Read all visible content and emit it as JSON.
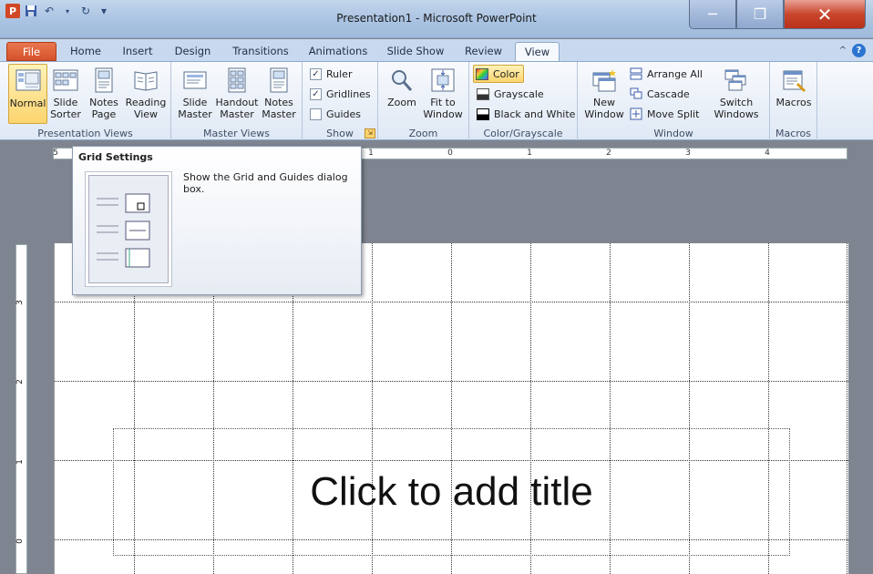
{
  "window": {
    "title": "Presentation1  -  Microsoft PowerPoint",
    "minimize": "─",
    "maximize": "❐",
    "close": "✕"
  },
  "qat": {
    "app_icon": "P",
    "save": "💾",
    "undo": "↶",
    "redo": "↻",
    "customize": "▾"
  },
  "tabs": [
    "File",
    "Home",
    "Insert",
    "Design",
    "Transitions",
    "Animations",
    "Slide Show",
    "Review",
    "View"
  ],
  "active_tab": "View",
  "ribbon": {
    "presentation_views": {
      "label": "Presentation Views",
      "normal": "Normal",
      "slide_sorter": "Slide Sorter",
      "notes_page": "Notes Page",
      "reading_view": "Reading View"
    },
    "master_views": {
      "label": "Master Views",
      "slide_master": "Slide Master",
      "handout_master": "Handout Master",
      "notes_master": "Notes Master"
    },
    "show": {
      "label": "Show",
      "ruler": "Ruler",
      "gridlines": "Gridlines",
      "guides": "Guides",
      "ruler_checked": true,
      "gridlines_checked": true,
      "guides_checked": false
    },
    "zoom": {
      "label": "Zoom",
      "zoom": "Zoom",
      "fit": "Fit to Window"
    },
    "color": {
      "label": "Color/Grayscale",
      "color": "Color",
      "grayscale": "Grayscale",
      "bw": "Black and White"
    },
    "window": {
      "label": "Window",
      "new_window": "New Window",
      "arrange_all": "Arrange All",
      "cascade": "Cascade",
      "move_split": "Move Split",
      "switch": "Switch Windows"
    },
    "macros": {
      "label": "Macros",
      "macros": "Macros"
    }
  },
  "tooltip": {
    "title": "Grid Settings",
    "description": "Show the Grid and Guides dialog box."
  },
  "ruler": {
    "h_labels": [
      "5",
      "1",
      "0",
      "1",
      "2",
      "3",
      "4"
    ],
    "v_labels": [
      "3",
      "2",
      "1",
      "0"
    ]
  },
  "slide": {
    "title_placeholder": "Click to add title"
  },
  "colors": {
    "accent_file": "#d6512a",
    "selected": "#fcd56f",
    "ribbon_bg": "#dfe8f5"
  }
}
